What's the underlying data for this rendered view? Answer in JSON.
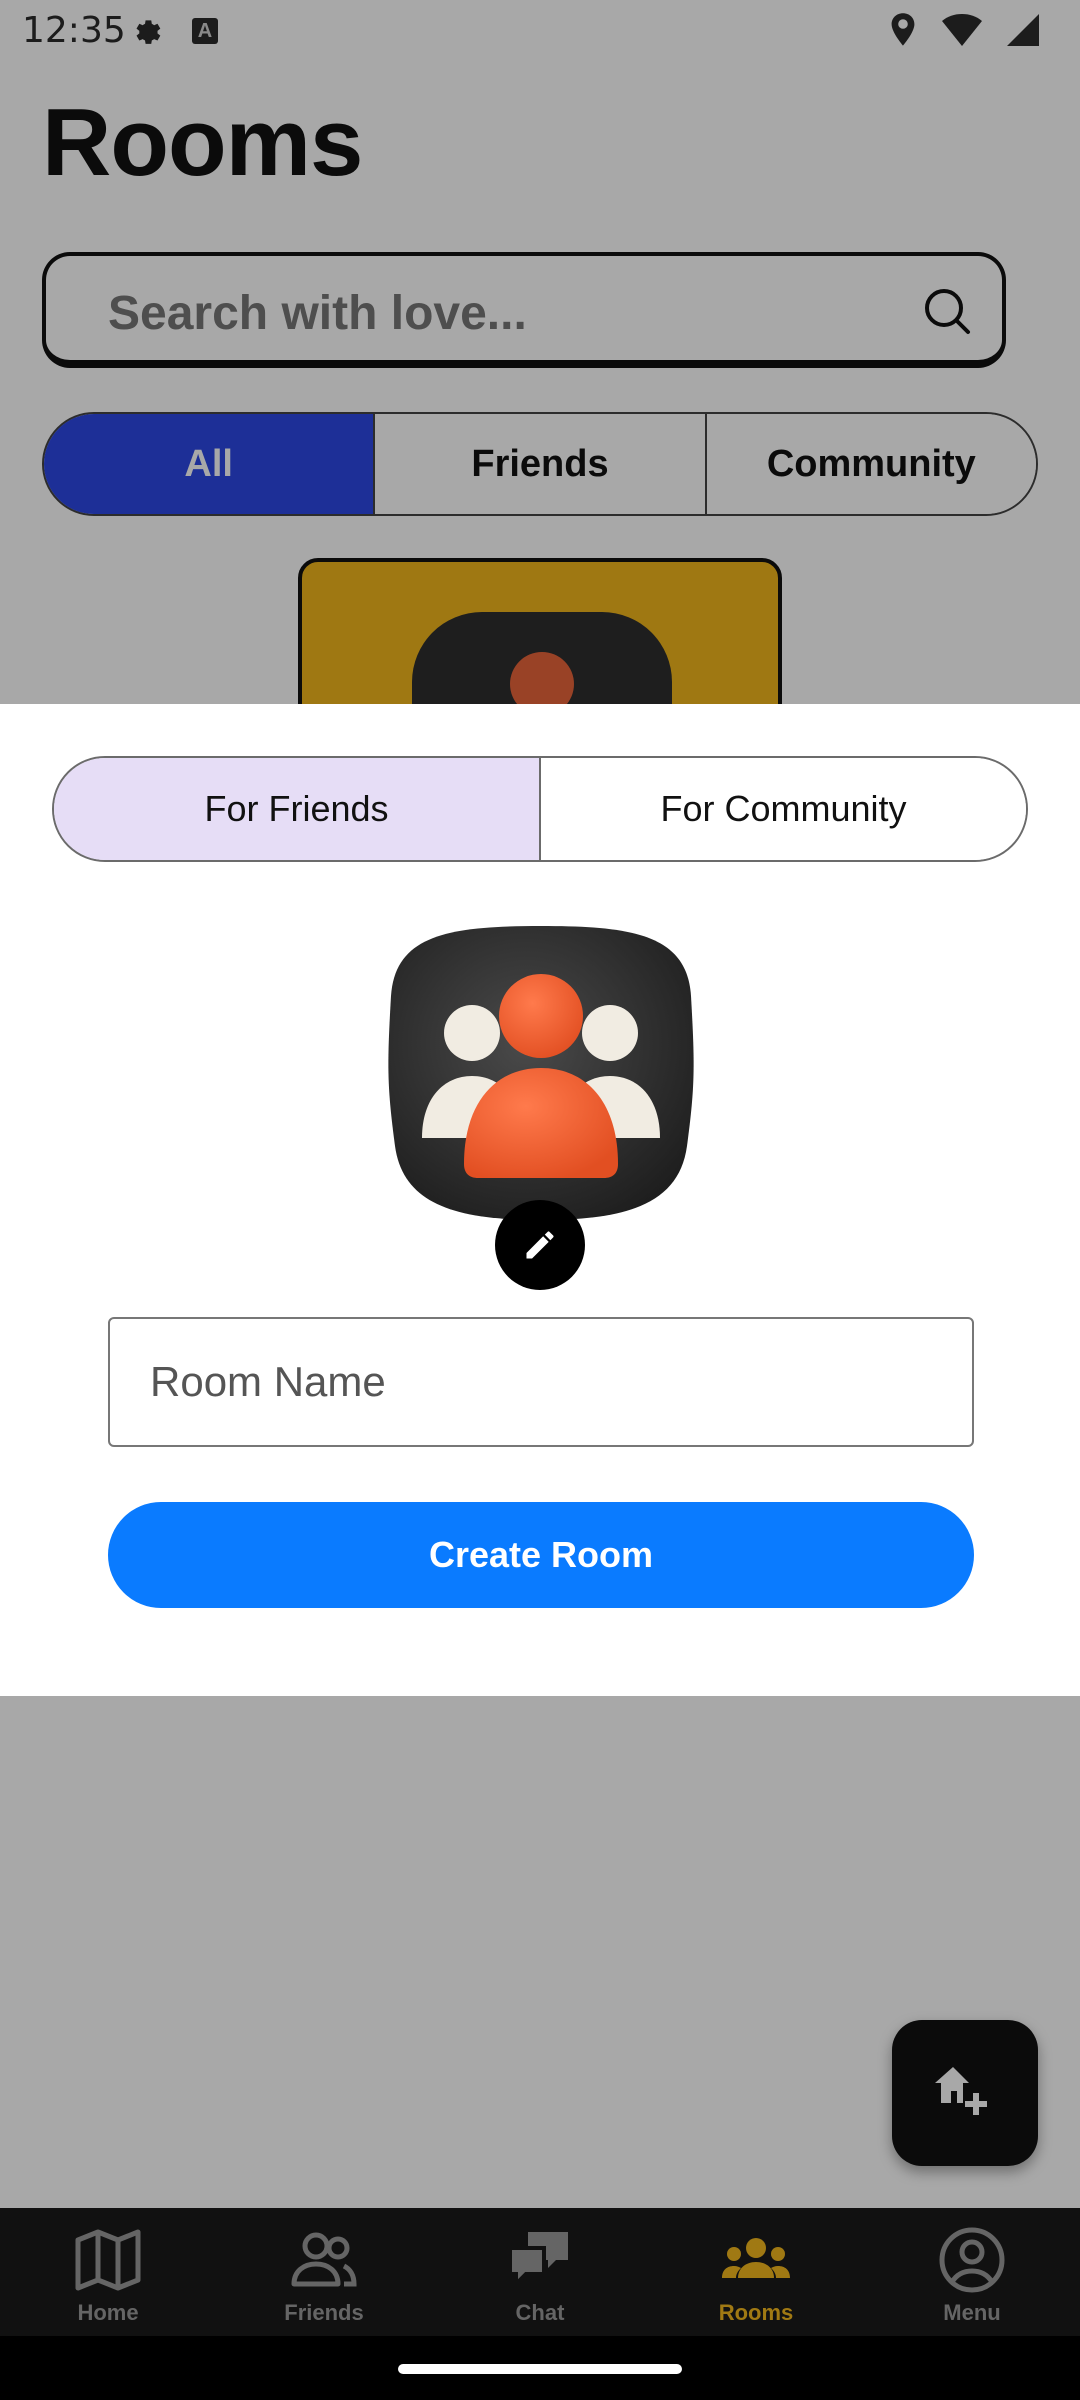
{
  "status_bar": {
    "time": "12:35",
    "badge_letter": "A"
  },
  "page": {
    "title": "Rooms"
  },
  "search": {
    "placeholder": "Search with love..."
  },
  "filter_tabs": [
    {
      "label": "All",
      "active": true
    },
    {
      "label": "Friends",
      "active": false
    },
    {
      "label": "Community",
      "active": false
    }
  ],
  "dialog": {
    "type_options": [
      {
        "label": "For Friends",
        "selected": true
      },
      {
        "label": "For Community",
        "selected": false
      }
    ],
    "room_name": {
      "placeholder": "Room Name",
      "value": ""
    },
    "create_label": "Create Room"
  },
  "bottom_nav": [
    {
      "label": "Home",
      "icon": "map-icon",
      "active": false
    },
    {
      "label": "Friends",
      "icon": "people-icon",
      "active": false
    },
    {
      "label": "Chat",
      "icon": "chat-bubbles-icon",
      "active": false
    },
    {
      "label": "Rooms",
      "icon": "group-icon",
      "active": true
    },
    {
      "label": "Menu",
      "icon": "account-circle-icon",
      "active": false
    }
  ],
  "colors": {
    "primary_blue": "#0a7bff",
    "tab_active_blue": "#2c48e6",
    "selected_lavender": "#e6ddf6",
    "rooms_gold": "#f3b81d",
    "avatar_orange": "#f0623a"
  }
}
